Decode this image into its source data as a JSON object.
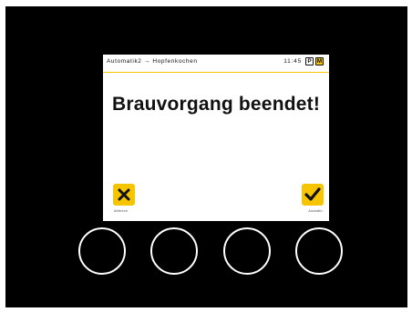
{
  "status_bar": {
    "breadcrumb": "Automatik2 → Hopfenkochen",
    "time": "11:45",
    "mode_p": "P",
    "mode_m": "M"
  },
  "dialog": {
    "message": "Brauvorgang beendet!"
  },
  "actions": {
    "cancel_icon": "close-icon",
    "cancel_caption": "Abbrech",
    "confirm_icon": "checkmark-icon",
    "confirm_caption": "Auswähl."
  },
  "colors": {
    "accent": "#f6c500",
    "device_frame": "#000000",
    "screen": "#ffffff"
  },
  "hardware_buttons": [
    "button-1",
    "button-2",
    "button-3",
    "button-4"
  ]
}
